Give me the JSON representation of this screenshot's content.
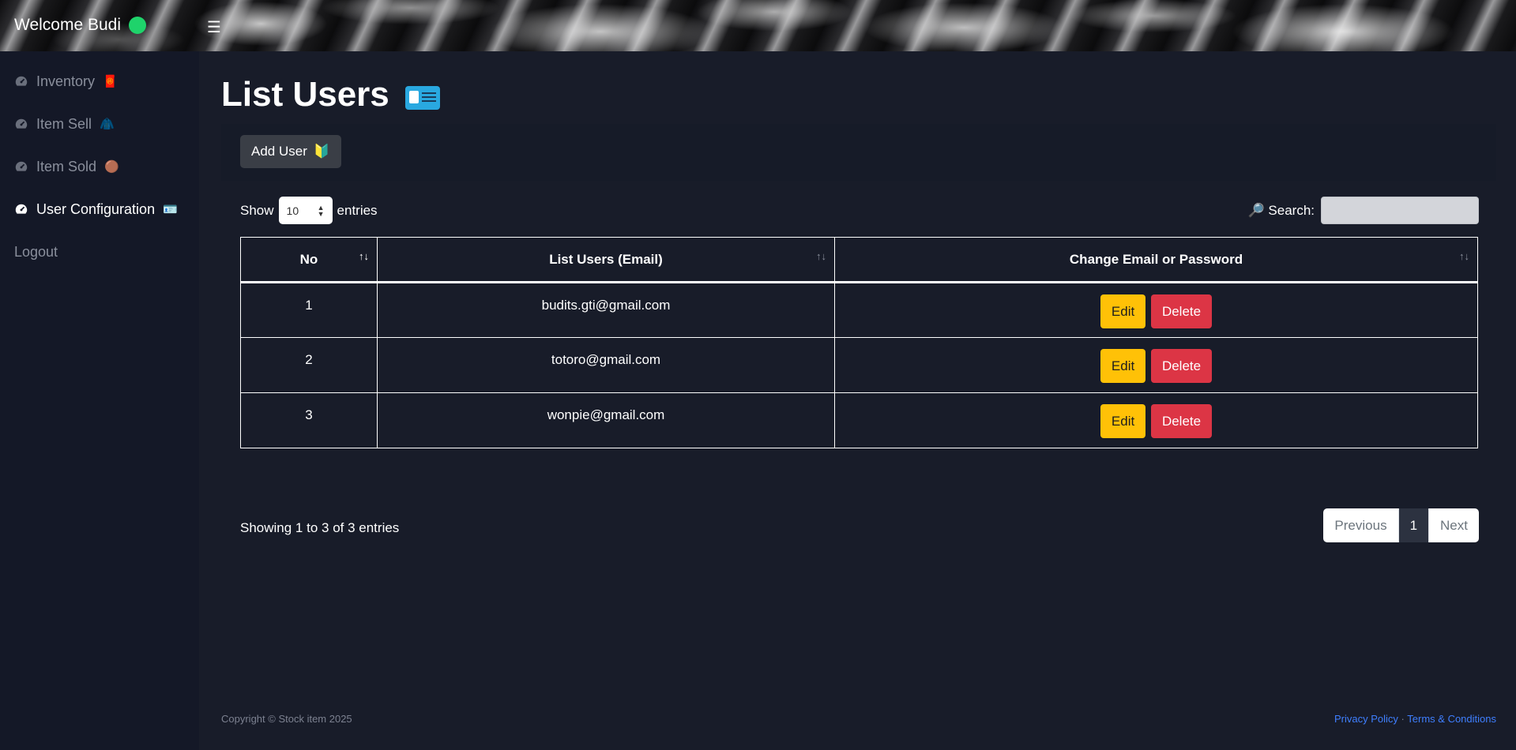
{
  "header": {
    "welcome": "Welcome Budi",
    "menu_toggle": "☰"
  },
  "sidebar": {
    "items": [
      {
        "label": "Inventory",
        "emoji": "🧧",
        "active": false
      },
      {
        "label": "Item Sell",
        "emoji": "🧥",
        "active": false
      },
      {
        "label": "Item Sold",
        "emoji": "🟤",
        "active": false
      },
      {
        "label": "User Configuration",
        "emoji": "🪪",
        "active": true
      }
    ],
    "logout": "Logout"
  },
  "page": {
    "title": "List Users",
    "add_user_label": "Add User",
    "add_user_emoji": "🔰"
  },
  "table_controls": {
    "show_label": "Show",
    "length_value": "10",
    "entries_label": "entries",
    "search_label": "🔎 Search:",
    "search_value": ""
  },
  "table": {
    "columns": [
      "No",
      "List Users (Email)",
      "Change Email or Password"
    ],
    "rows": [
      {
        "no": "1",
        "email": "budits.gti@gmail.com"
      },
      {
        "no": "2",
        "email": "totoro@gmail.com"
      },
      {
        "no": "3",
        "email": "wonpie@gmail.com"
      }
    ],
    "edit_label": "Edit",
    "delete_label": "Delete"
  },
  "pagination": {
    "info": "Showing 1 to 3 of 3 entries",
    "previous": "Previous",
    "current": "1",
    "next": "Next"
  },
  "footer": {
    "copyright": "Copyright © Stock item 2025",
    "privacy": "Privacy Policy",
    "separator": "·",
    "terms": "Terms & Conditions"
  },
  "colors": {
    "status_dot": "#1fd36b",
    "edit": "#ffc107",
    "delete": "#dc3545",
    "link": "#3f7fff"
  }
}
